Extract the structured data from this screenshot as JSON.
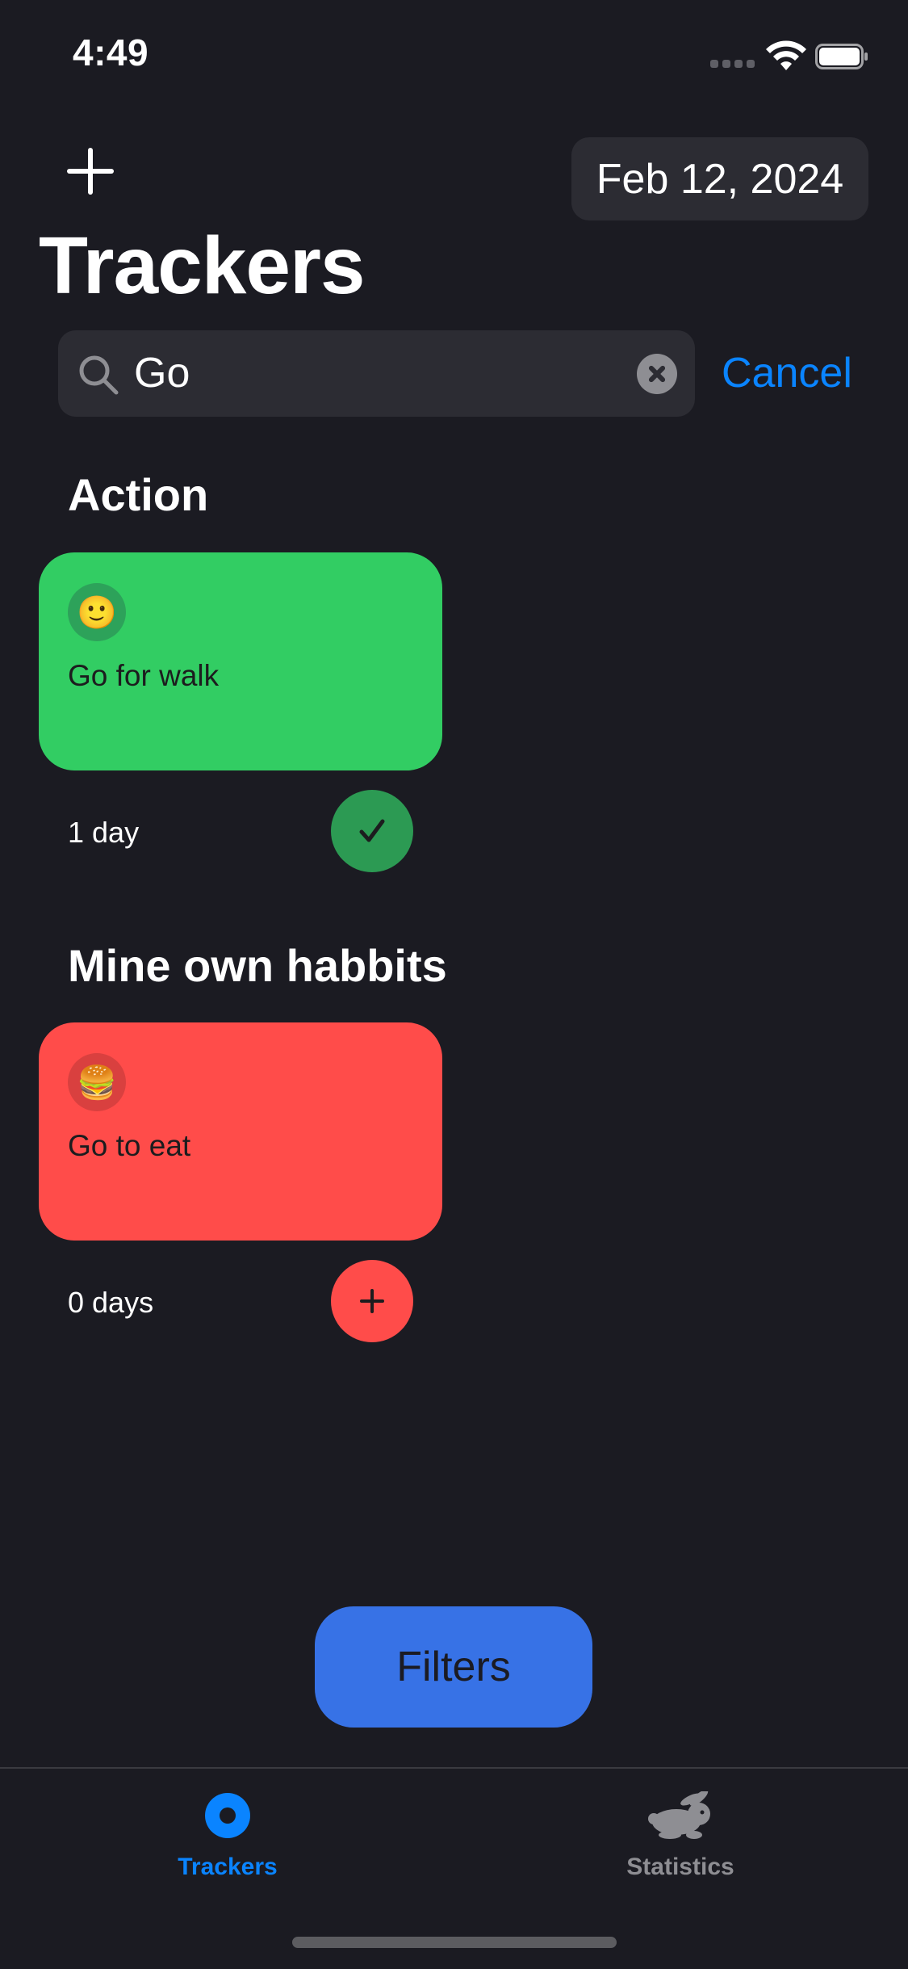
{
  "status_bar": {
    "time": "4:49"
  },
  "header": {
    "date": "Feb 12, 2024",
    "title": "Trackers"
  },
  "search": {
    "query": "Go",
    "cancel_label": "Cancel"
  },
  "sections": [
    {
      "title": "Action",
      "trackers": [
        {
          "emoji": "🙂",
          "name": "Go for walk",
          "days": "1 day",
          "color": "#32cd63",
          "done": true
        }
      ]
    },
    {
      "title": "Mine own habbits",
      "trackers": [
        {
          "emoji": "🍔",
          "name": "Go to eat",
          "days": "0 days",
          "color": "#ff4c4a",
          "done": false
        }
      ]
    }
  ],
  "filters_label": "Filters",
  "tab_bar": {
    "items": [
      {
        "label": "Trackers",
        "icon": "trackers-icon",
        "active": true,
        "color": "#0a84ff"
      },
      {
        "label": "Statistics",
        "icon": "rabbit-icon",
        "active": false,
        "color": "#8e8e93"
      }
    ]
  }
}
